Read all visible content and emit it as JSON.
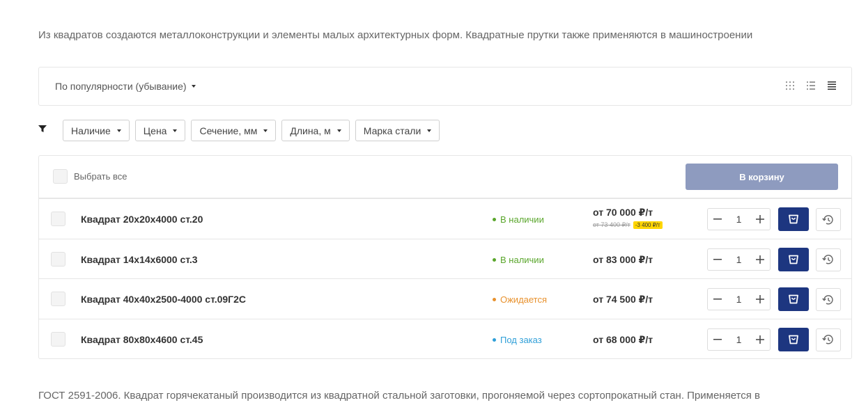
{
  "intro_text": "Из квадратов создаются металлоконструкции и элементы малых архитектурных форм. Квадратные прутки также применяются в машиностроении",
  "sort": {
    "label": "По популярности (убывание)"
  },
  "view_icons": [
    "grid-view-icon",
    "list-view-icon",
    "table-view-icon"
  ],
  "filters": [
    "Наличие",
    "Цена",
    "Сечение, мм",
    "Длина, м",
    "Марка стали"
  ],
  "panel": {
    "select_all_label": "Выбрать все",
    "add_to_cart_label": "В корзину"
  },
  "products": [
    {
      "name": "Квадрат 20x20x4000 ст.20",
      "status": "В наличии",
      "status_color": "#5aa62c",
      "price": "от 70 000 ₽/т",
      "old_price": "от 73 400 ₽/т",
      "discount": "-3 400 ₽/т",
      "qty": "1"
    },
    {
      "name": "Квадрат 14x14x6000 ст.3",
      "status": "В наличии",
      "status_color": "#5aa62c",
      "price": "от 83 000 ₽/т",
      "qty": "1"
    },
    {
      "name": "Квадрат 40x40x2500-4000 ст.09Г2С",
      "status": "Ожидается",
      "status_color": "#e8912d",
      "price": "от 74 500 ₽/т",
      "qty": "1"
    },
    {
      "name": "Квадрат 80x80x4600 ст.45",
      "status": "Под заказ",
      "status_color": "#2f9fd8",
      "price": "от 68 000 ₽/т",
      "qty": "1"
    }
  ],
  "outro_text": "ГОСТ 2591-2006. Квадрат горячекатаный производится из квадратной стальной заготовки, прогоняемой через сортопрокатный стан. Применяется в",
  "colors": {
    "primary": "#1d3680",
    "disabled_button": "#8e9bbf",
    "border": "#e6e6e6"
  }
}
